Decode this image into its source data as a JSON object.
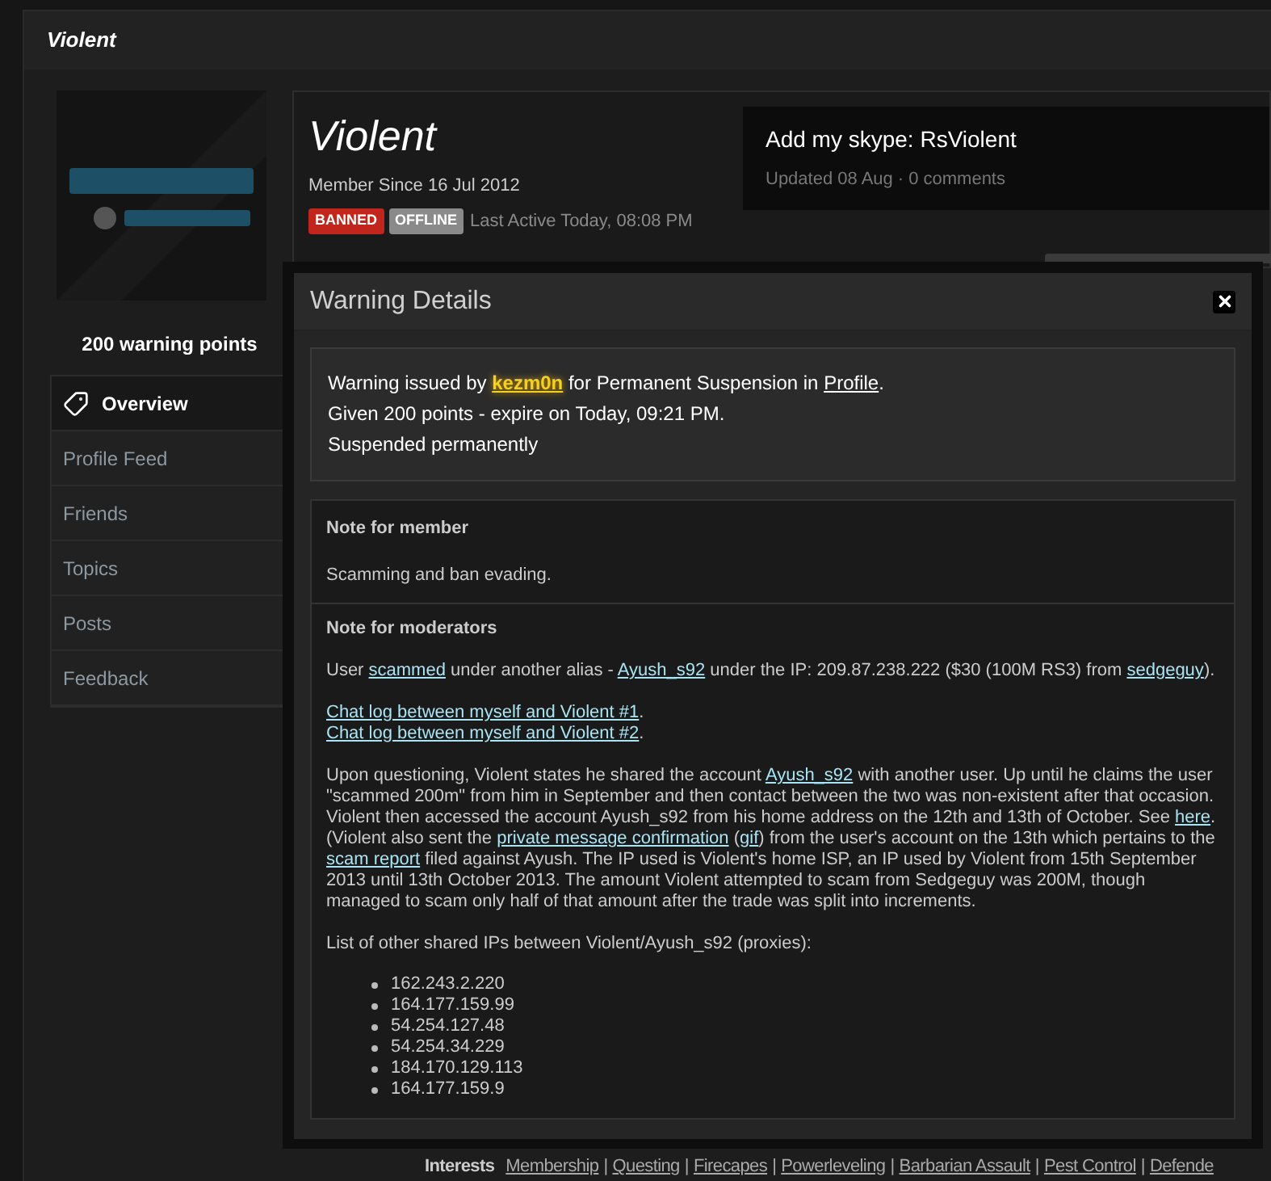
{
  "page_title": "Violent",
  "profile": {
    "warning_points": "200 warning points",
    "name": "Violent",
    "member_since": "Member Since 16 Jul 2012",
    "last_active": "Last Active Today, 08:08 PM",
    "badges": [
      {
        "label": "BANNED",
        "kind": "banned"
      },
      {
        "label": "OFFLINE",
        "kind": "offline"
      }
    ]
  },
  "nav": [
    {
      "label": "Overview",
      "selected": true
    },
    {
      "label": "Profile Feed",
      "selected": false
    },
    {
      "label": "Friends",
      "selected": false
    },
    {
      "label": "Topics",
      "selected": false
    },
    {
      "label": "Posts",
      "selected": false
    },
    {
      "label": "Feedback",
      "selected": false
    }
  ],
  "status": {
    "text": "Add my skype: RsViolent",
    "updated": "Updated 08 Aug",
    "separator": "·",
    "comments": "0 comments"
  },
  "modal": {
    "title": "Warning Details",
    "summary": [
      [
        {
          "kind": "text",
          "text": "Warning issued by "
        },
        {
          "kind": "user",
          "text": "kezm0n"
        },
        {
          "kind": "text",
          "text": " for Permanent Suspension in "
        },
        {
          "kind": "link",
          "text": "Profile"
        },
        {
          "kind": "text",
          "text": "."
        }
      ],
      [
        {
          "kind": "text",
          "text": "Given 200 points - expire on Today, 09:21 PM."
        }
      ],
      [
        {
          "kind": "text",
          "text": "Suspended permanently"
        }
      ]
    ],
    "note_member": {
      "heading": "Note for member",
      "text": "Scamming and ban evading."
    },
    "note_moderators": {
      "heading": "Note for moderators",
      "paragraphs": [
        [
          [
            {
              "kind": "text",
              "text": "User "
            },
            {
              "kind": "link",
              "text": "scammed"
            },
            {
              "kind": "text",
              "text": " under another alias - "
            },
            {
              "kind": "link",
              "text": "Ayush_s92"
            },
            {
              "kind": "text",
              "text": " under the IP: 209.87.238.222 ($30 (100M RS3) from "
            },
            {
              "kind": "link",
              "text": "sedgeguy"
            },
            {
              "kind": "text",
              "text": ")."
            }
          ]
        ],
        [
          [
            {
              "kind": "link",
              "text": "Chat log between myself and Violent #1"
            },
            {
              "kind": "text",
              "text": "."
            }
          ],
          [
            {
              "kind": "link",
              "text": "Chat log between myself and Violent #2"
            },
            {
              "kind": "text",
              "text": "."
            }
          ]
        ],
        [
          [
            {
              "kind": "text",
              "text": "Upon questioning, Violent states he shared the account "
            },
            {
              "kind": "link",
              "text": "Ayush_s92"
            },
            {
              "kind": "text",
              "text": " with another user. Up until he claims the user \"scammed 200m\" from him in September and then contact between the two was non-existent after that occasion. Violent then accessed the account Ayush_s92 from his home address on the 12th and 13th of October. See "
            },
            {
              "kind": "link",
              "text": "here"
            },
            {
              "kind": "text",
              "text": "."
            }
          ],
          [
            {
              "kind": "text",
              "text": "(Violent also sent the "
            },
            {
              "kind": "link",
              "text": "private message confirmation"
            },
            {
              "kind": "text",
              "text": " ("
            },
            {
              "kind": "link",
              "text": "gif"
            },
            {
              "kind": "text",
              "text": ") from the user's account on the 13th which pertains to the "
            },
            {
              "kind": "link",
              "text": "scam report"
            },
            {
              "kind": "text",
              "text": " filed against Ayush. The IP used is Violent's home ISP, an IP used by Violent from 15th September 2013 until 13th October 2013. The amount Violent attempted to scam from Sedgeguy was 200M, though managed to scam only half of that amount after the trade was split into increments."
            }
          ]
        ],
        [
          [
            {
              "kind": "text",
              "text": "List of other shared IPs between Violent/Ayush_s92 (proxies):"
            }
          ]
        ]
      ],
      "ips": [
        "162.243.2.220",
        "164.177.159.99",
        "54.254.127.48",
        "54.254.34.229",
        "184.170.129.113",
        "164.177.159.9"
      ]
    }
  },
  "interests": {
    "label": "Interests",
    "separator": "|",
    "items": [
      "Membership",
      "Questing",
      "Firecapes",
      "Powerleveling",
      "Barbarian Assault",
      "Pest Control",
      "Defende"
    ]
  }
}
